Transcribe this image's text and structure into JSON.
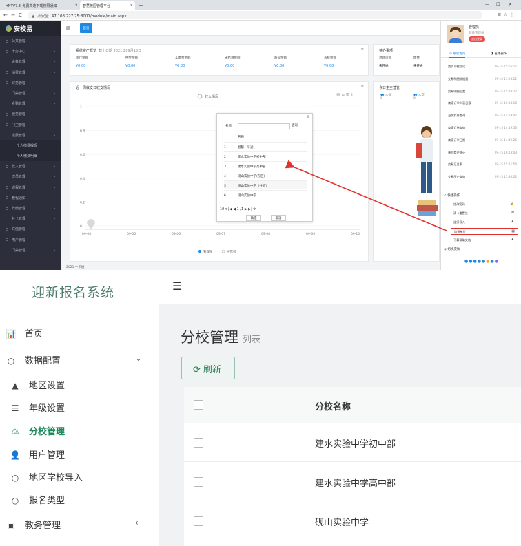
{
  "top": {
    "browser": {
      "tab1": "HNTV7.3_免费高速下载仅限通知",
      "tab2": "智慧校园管理平台",
      "url": "47.108.227.25:8001/module/main.aspx",
      "url_warning": "不安全"
    },
    "app_name": "安校易",
    "home_tab": "首页",
    "sidebar": [
      {
        "label": "公共管理"
      },
      {
        "label": "卡务中心"
      },
      {
        "label": "设备管理"
      },
      {
        "label": "消费管理"
      },
      {
        "label": "财务管理"
      },
      {
        "label": "门禁管理"
      },
      {
        "label": "考勤管理"
      },
      {
        "label": "服务管理"
      },
      {
        "label": "门卫管理"
      },
      {
        "label": "退费管理"
      },
      {
        "label": "个人缴费提现",
        "sub": true
      },
      {
        "label": "个人缴费明细",
        "sub": true
      },
      {
        "label": "收入管理"
      },
      {
        "label": "成员管理"
      },
      {
        "label": "课程管理"
      },
      {
        "label": "教程通知"
      },
      {
        "label": "代缴管理"
      },
      {
        "label": "补卡管理"
      },
      {
        "label": "充值管理"
      },
      {
        "label": "用户管理"
      },
      {
        "label": "门禁管理"
      }
    ],
    "assets": {
      "title": "系统资产概览",
      "updated": "截止日期 2021年09月15日",
      "items": [
        {
          "label": "现行余额",
          "value": "¥0.00"
        },
        {
          "label": "押金余额",
          "value": "¥0.00"
        },
        {
          "label": "工本费余额",
          "value": "¥0.00"
        },
        {
          "label": "未结算余额",
          "value": "¥0.00"
        },
        {
          "label": "账号余额",
          "value": "¥0.00"
        },
        {
          "label": "系统余额",
          "value": "¥0.00"
        }
      ]
    },
    "todo": {
      "title": "待办事项",
      "items": [
        {
          "label": "退款审批",
          "value": "未开通"
        },
        {
          "label": "缴费",
          "value": "未开通"
        }
      ]
    },
    "income": {
      "title": "近一周收支日收支情况",
      "legend": "收入情况",
      "legend2": "管理员",
      "legend3": "经营者",
      "footer": "2021 一卡通"
    },
    "today": {
      "title": "今日主主营管",
      "a": "人数",
      "b": "人次"
    },
    "popup": {
      "search_label": "名称",
      "search_btn": "查询",
      "col_name": "名称",
      "rows": [
        {
          "n": "1",
          "name": "智慧一号通"
        },
        {
          "n": "2",
          "name": "建水实验中学初中部"
        },
        {
          "n": "3",
          "name": "建水实验中学高中部"
        },
        {
          "n": "4",
          "name": "砚山实验中学(东区)"
        },
        {
          "n": "5",
          "name": "砚山实验中学（住宿）"
        },
        {
          "n": "6",
          "name": "砚山实验中学"
        }
      ],
      "pager": "10 ▾  |◀  ◀  1  /1  ▶  ▶|  ⟳",
      "ok": "确定",
      "cancel": "取消"
    },
    "user": {
      "name": "管理员",
      "role": "超级管理员",
      "logout": "退出登录"
    },
    "rp_tabs": {
      "recent": "最近访问",
      "quick": "已用操作"
    },
    "recent": [
      {
        "name": "首页功能优化",
        "time": "09-15 15:05:17"
      },
      {
        "name": "交易明细数据量",
        "time": "09-15 15:28:22"
      },
      {
        "name": "交易明细设置",
        "time": "09-15 15:28:22"
      },
      {
        "name": "商家订单列表日报",
        "time": "09-15 15:04:18"
      },
      {
        "name": "当前交易查询",
        "time": "09-15 14:59:47"
      },
      {
        "name": "商家订单查询",
        "time": "09-15 14:49:53"
      },
      {
        "name": "商家订单日报",
        "time": "09-15 14:49:26"
      },
      {
        "name": "单位商户统计",
        "time": "09-15 16:13:03"
      },
      {
        "name": "交易汇总表",
        "time": "09-15 15:51:54"
      },
      {
        "name": "交易历史查询",
        "time": "09-15 15:30:22"
      }
    ],
    "quick_title": "快捷操作",
    "quick": [
      {
        "name": "修改密码",
        "icon": "🔒"
      },
      {
        "name": "清卡重置位",
        "icon": "⟲"
      },
      {
        "name": "连接导入",
        "icon": "⛰"
      },
      {
        "name": "选择单位",
        "icon": "▦"
      },
      {
        "name": "下载帮助文档",
        "icon": "⛰"
      }
    ],
    "theme_title": "切换皮肤"
  },
  "bottom": {
    "brand": "迎新报名系统",
    "nav": [
      {
        "label": "首页",
        "icon": "📊"
      },
      {
        "label": "数据配置",
        "icon": "○",
        "chev": "⌄"
      },
      {
        "label": "地区设置",
        "icon": "▲",
        "sub": true
      },
      {
        "label": "年级设置",
        "icon": "☰",
        "sub": true
      },
      {
        "label": "分校管理",
        "icon": "⚖",
        "sub": true,
        "active": true
      },
      {
        "label": "用户管理",
        "icon": "👤",
        "sub": true
      },
      {
        "label": "地区学校导入",
        "icon": "○",
        "sub": true
      },
      {
        "label": "报名类型",
        "icon": "○",
        "sub": true
      },
      {
        "label": "教务管理",
        "icon": "▣",
        "chev": "‹"
      }
    ],
    "page_title": "分校管理",
    "page_subtitle": "列表",
    "refresh": "刷新",
    "table": {
      "header": "分校名称",
      "rows": [
        "建水实验中学初中部",
        "建水实验中学高中部",
        "砚山实验中学"
      ]
    },
    "accent": "#1f8a5d"
  }
}
